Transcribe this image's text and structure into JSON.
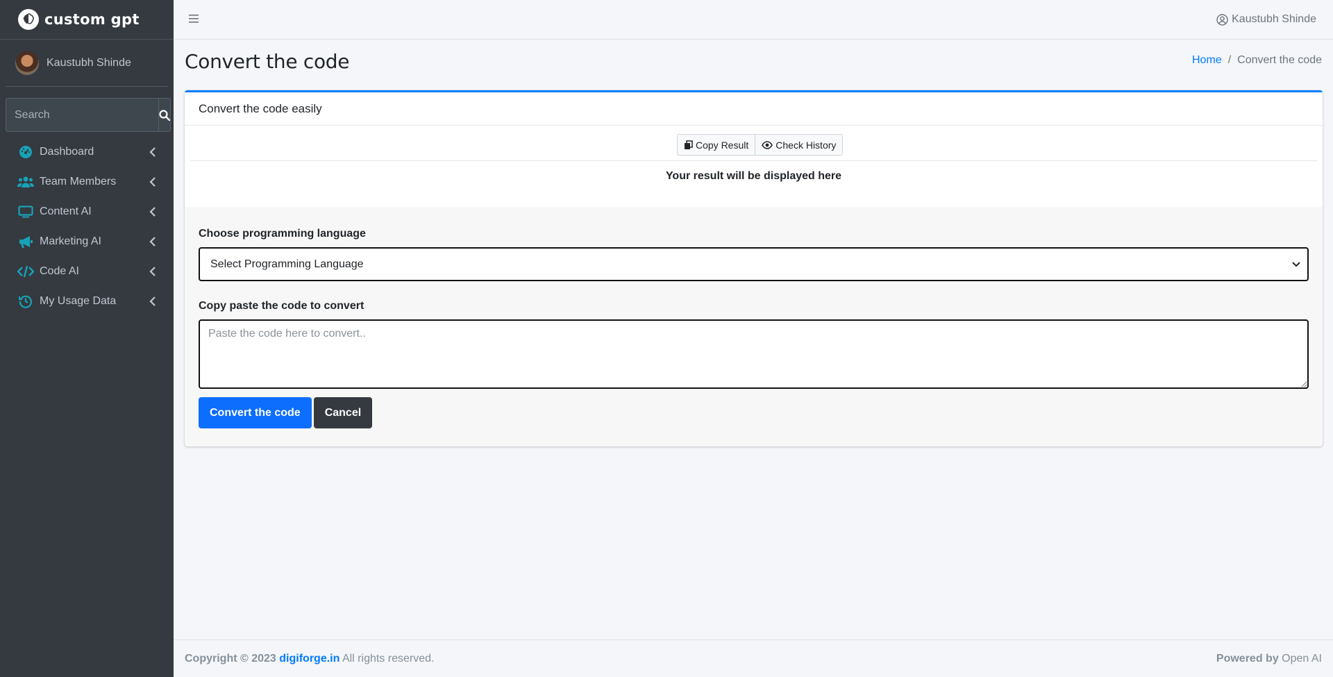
{
  "brand": {
    "name": "custom gpt"
  },
  "sidebar": {
    "user_name": "Kaustubh Shinde",
    "search_placeholder": "Search",
    "items": [
      {
        "label": "Dashboard",
        "icon": "dashboard-icon"
      },
      {
        "label": "Team Members",
        "icon": "users-icon"
      },
      {
        "label": "Content AI",
        "icon": "monitor-icon"
      },
      {
        "label": "Marketing AI",
        "icon": "megaphone-icon"
      },
      {
        "label": "Code AI",
        "icon": "code-icon"
      },
      {
        "label": "My Usage Data",
        "icon": "history-icon"
      }
    ]
  },
  "topbar": {
    "user_name": "Kaustubh Shinde"
  },
  "page": {
    "title": "Convert the code",
    "breadcrumb": {
      "home": "Home",
      "current": "Convert the code"
    }
  },
  "card": {
    "title": "Convert the code easily",
    "copy_result_label": "Copy Result",
    "check_history_label": "Check History",
    "result_placeholder": "Your result will be displayed here",
    "language_label": "Choose programming language",
    "language_selected": "Select Programming Language",
    "code_label": "Copy paste the code to convert",
    "code_placeholder": "Paste the code here to convert..",
    "submit_label": "Convert the code",
    "cancel_label": "Cancel"
  },
  "footer": {
    "copyright": "Copyright © 2023",
    "site": "digiforge.in",
    "rights": "All rights reserved.",
    "powered_by": "Powered by",
    "powered_name": "Open AI"
  },
  "colors": {
    "accent": "#007bff",
    "primary_button": "#0d6efd",
    "sidebar_bg": "#343a40",
    "icon_teal": "#17a2b8"
  }
}
